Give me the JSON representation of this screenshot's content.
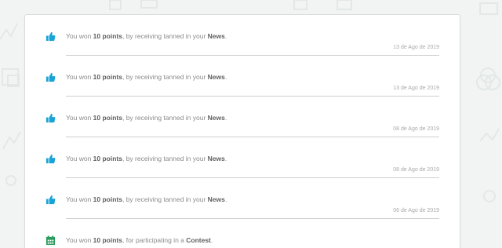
{
  "notifications": [
    {
      "icon": "thumbs-up-icon",
      "prefix": "You won ",
      "points": "10 points",
      "middle": ", by receiving tanned in your ",
      "target": "News",
      "suffix": ".",
      "date": "13 de Ago de 2019"
    },
    {
      "icon": "thumbs-up-icon",
      "prefix": "You won ",
      "points": "10 points",
      "middle": ", by receiving tanned in your ",
      "target": "News",
      "suffix": ".",
      "date": "13 de Ago de 2019"
    },
    {
      "icon": "thumbs-up-icon",
      "prefix": "You won ",
      "points": "10 points",
      "middle": ", by receiving tanned in your ",
      "target": "News",
      "suffix": ".",
      "date": "08 de Ago de 2019"
    },
    {
      "icon": "thumbs-up-icon",
      "prefix": "You won ",
      "points": "10 points",
      "middle": ", by receiving tanned in your ",
      "target": "News",
      "suffix": ".",
      "date": "08 de Ago de 2019"
    },
    {
      "icon": "thumbs-up-icon",
      "prefix": "You won ",
      "points": "10 points",
      "middle": ", by receiving tanned in your ",
      "target": "News",
      "suffix": ".",
      "date": "06 de Ago de 2019"
    },
    {
      "icon": "calendar-icon",
      "prefix": "You won ",
      "points": "10 points",
      "middle": ", for participating in a ",
      "target": "Contest",
      "suffix": ".",
      "date": ""
    }
  ],
  "colors": {
    "thumbs_icon": "#1aa3d6",
    "calendar_icon": "#2a9d5c",
    "background": "#f1f4f3"
  }
}
